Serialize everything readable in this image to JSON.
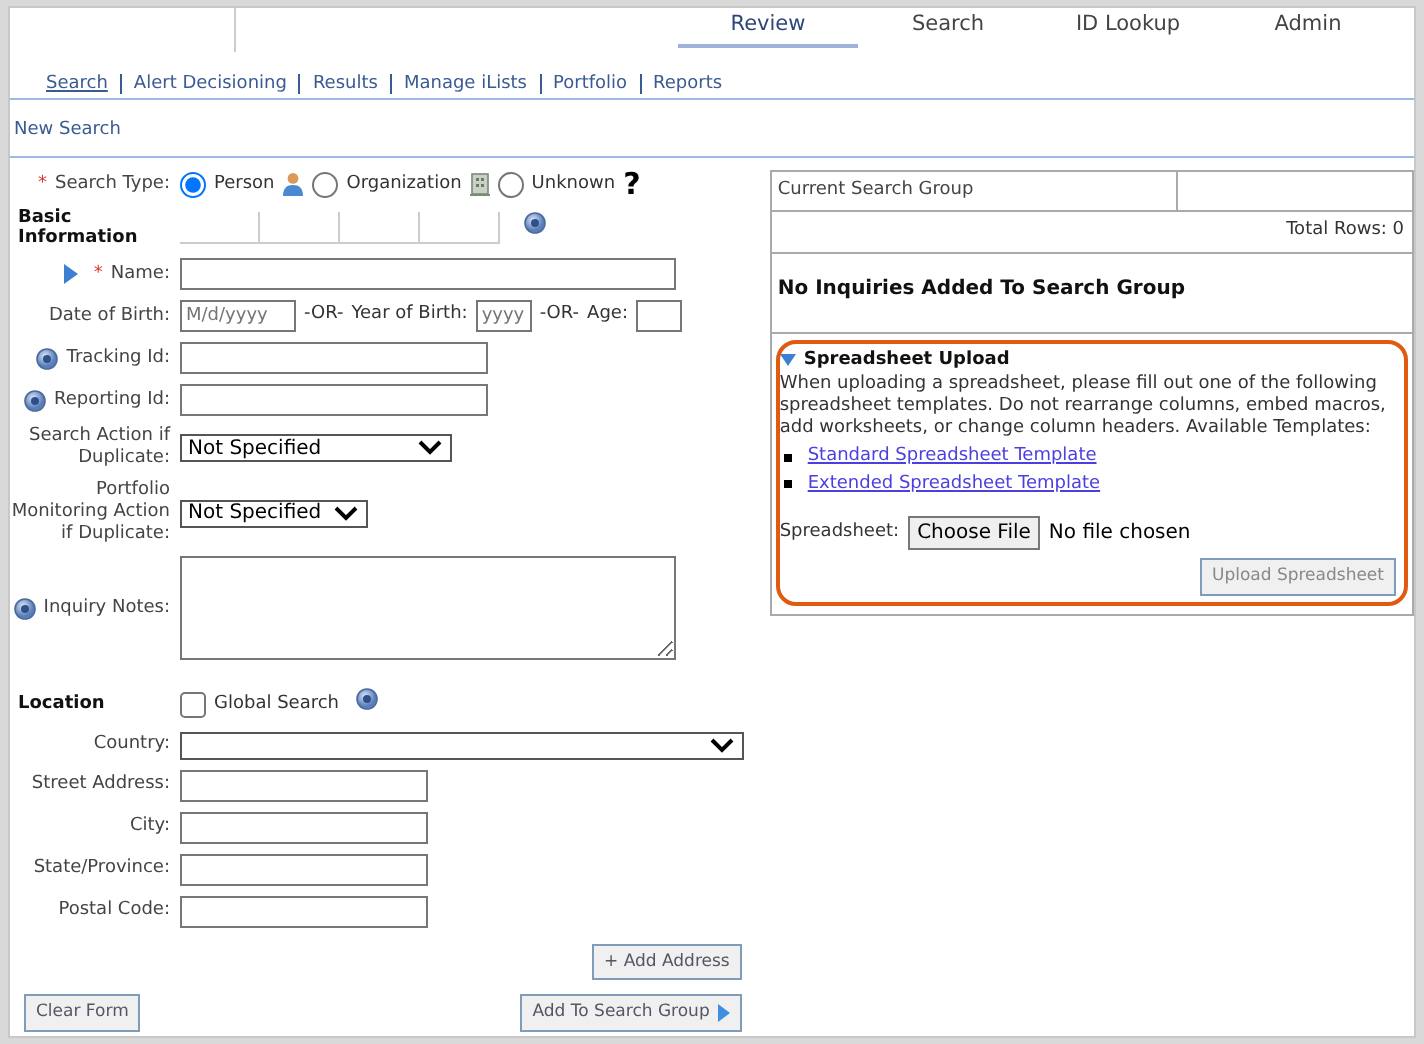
{
  "top_tabs": [
    {
      "label": "Review",
      "selected": true
    },
    {
      "label": "Search",
      "selected": false
    },
    {
      "label": "ID Lookup",
      "selected": false
    },
    {
      "label": "Admin",
      "selected": false
    }
  ],
  "sub_nav": [
    {
      "label": "Search",
      "selected": true
    },
    {
      "label": "Alert Decisioning",
      "selected": false
    },
    {
      "label": "Results",
      "selected": false
    },
    {
      "label": "Manage iLists",
      "selected": false
    },
    {
      "label": "Portfolio",
      "selected": false
    },
    {
      "label": "Reports",
      "selected": false
    }
  ],
  "page_title": "New Search",
  "search_type": {
    "required_mark": "*",
    "label": "Search Type:",
    "options": [
      {
        "label": "Person",
        "selected": true,
        "kind": "person"
      },
      {
        "label": "Organization",
        "selected": false,
        "kind": "organization"
      },
      {
        "label": "Unknown",
        "selected": false,
        "kind": "unknown",
        "glyph": "?"
      }
    ]
  },
  "basic_information": {
    "heading": "Basic Information"
  },
  "fields": [
    {
      "kind": "long",
      "expander": true,
      "required_mark": "*",
      "label": "Name:"
    },
    {
      "kind": "dob",
      "label": "Date of Birth:",
      "placeholder": "M/d/yyyy",
      "or_1": "-OR-",
      "year_label": "Year of Birth:",
      "year_placeholder": "yyyy",
      "or_2": "-OR-",
      "age_label": "Age:"
    },
    {
      "kind": "medium",
      "help": true,
      "label": "Tracking Id:"
    },
    {
      "kind": "medium",
      "help": true,
      "label": "Reporting Id:"
    },
    {
      "kind": "select",
      "label": "Search Action if Duplicate:",
      "value": "Not Specified"
    },
    {
      "kind": "select-short",
      "label": "Portfolio Monitoring Action if Duplicate:",
      "value": "Not Specified"
    },
    {
      "kind": "textarea",
      "help": true,
      "label": "Inquiry Notes:"
    }
  ],
  "location": {
    "heading": "Location",
    "global_search": {
      "label": "Global Search",
      "checked": false
    }
  },
  "location_fields": [
    {
      "kind": "select-wide",
      "label": "Country:"
    },
    {
      "kind": "short",
      "label": "Street Address:"
    },
    {
      "kind": "short",
      "label": "City:"
    },
    {
      "kind": "short",
      "label": "State/Province:"
    },
    {
      "kind": "short",
      "label": "Postal Code:"
    }
  ],
  "add_address_button": "+ Add Address",
  "clear_form_button": "Clear Form",
  "add_to_group_button": "Add To Search Group",
  "search_group": {
    "header": "Current Search Group",
    "total_rows": "Total Rows: 0",
    "empty_message": "No Inquiries Added To Search Group"
  },
  "spreadsheet_upload": {
    "title": "Spreadsheet Upload",
    "expanded": true,
    "highlighted": true,
    "description": "When uploading a spreadsheet, please fill out one of the following spreadsheet templates. Do not rearrange columns, embed macros, add worksheets, or change column headers. Available Templates:",
    "templates": [
      "Standard Spreadsheet Template",
      "Extended Spreadsheet Template"
    ],
    "file_label": "Spreadsheet:",
    "choose_button": "Choose File",
    "file_status": "No file chosen",
    "upload_button": {
      "label": "Upload Spreadsheet",
      "disabled": true
    }
  }
}
